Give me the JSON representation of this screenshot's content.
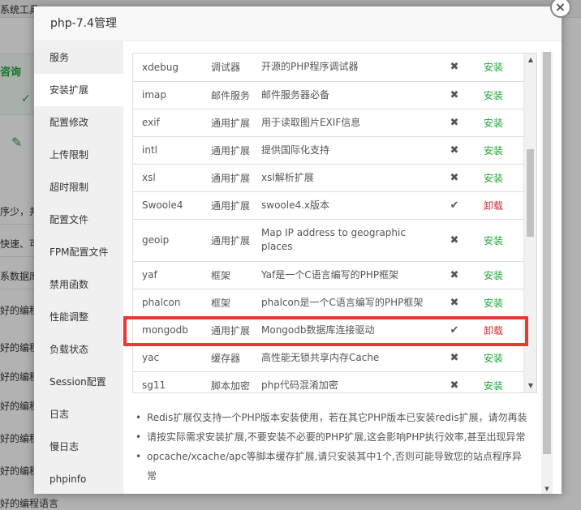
{
  "background": {
    "tab_label": "系统工具",
    "green_heading": "咨询",
    "lines": [
      "序少，并",
      "快速、可",
      "系数据库",
      "好的编程",
      "好的编程",
      "好的编程",
      "好的编程",
      "好的编程",
      "好的编程",
      "好的编程语言"
    ]
  },
  "dialog": {
    "title": "php-7.4管理",
    "close_label": "×"
  },
  "sidebar": {
    "items": [
      {
        "label": "服务"
      },
      {
        "label": "安装扩展"
      },
      {
        "label": "配置修改"
      },
      {
        "label": "上传限制"
      },
      {
        "label": "超时限制"
      },
      {
        "label": "配置文件"
      },
      {
        "label": "FPM配置文件"
      },
      {
        "label": "禁用函数"
      },
      {
        "label": "性能调整"
      },
      {
        "label": "负载状态"
      },
      {
        "label": "Session配置"
      },
      {
        "label": "日志"
      },
      {
        "label": "慢日志"
      },
      {
        "label": "phpinfo"
      }
    ]
  },
  "extensions": {
    "status_icons": {
      "installed": "✔",
      "not_installed": "✖"
    },
    "rows": [
      {
        "name": "xdebug",
        "type": "调试器",
        "desc": "开源的PHP程序调试器",
        "status": "not_installed",
        "action": "安装"
      },
      {
        "name": "imap",
        "type": "邮件服务",
        "desc": "邮件服务器必备",
        "status": "not_installed",
        "action": "安装"
      },
      {
        "name": "exif",
        "type": "通用扩展",
        "desc": "用于读取图片EXIF信息",
        "status": "not_installed",
        "action": "安装"
      },
      {
        "name": "intl",
        "type": "通用扩展",
        "desc": "提供国际化支持",
        "status": "not_installed",
        "action": "安装"
      },
      {
        "name": "xsl",
        "type": "通用扩展",
        "desc": "xsl解析扩展",
        "status": "not_installed",
        "action": "安装"
      },
      {
        "name": "Swoole4",
        "type": "通用扩展",
        "desc": "swoole4.x版本",
        "status": "installed",
        "action": "卸载"
      },
      {
        "name": "geoip",
        "type": "通用扩展",
        "desc": "Map IP address to geographic places",
        "status": "not_installed",
        "action": "安装"
      },
      {
        "name": "yaf",
        "type": "框架",
        "desc": "Yaf是一个C语言编写的PHP框架",
        "status": "not_installed",
        "action": "安装"
      },
      {
        "name": "phalcon",
        "type": "框架",
        "desc": "phalcon是一个C语言编写的PHP框架",
        "status": "not_installed",
        "action": "安装"
      },
      {
        "name": "mongodb",
        "type": "通用扩展",
        "desc": "Mongodb数据库连接驱动",
        "status": "installed",
        "action": "卸载"
      },
      {
        "name": "yac",
        "type": "缓存器",
        "desc": "高性能无锁共享内存Cache",
        "status": "not_installed",
        "action": "安装"
      },
      {
        "name": "sg11",
        "type": "脚本加密",
        "desc": "php代码混淆加密",
        "status": "not_installed",
        "action": "安装"
      }
    ]
  },
  "notes": [
    "Redis扩展仅支持一个PHP版本安装使用，若在其它PHP版本已安装redis扩展，请勿再装",
    "请按实际需求安装扩展,不要安装不必要的PHP扩展,这会影响PHP执行效率,甚至出现异常",
    "opcache/xcache/apc等脚本缓存扩展,请只安装其中1个,否则可能导致您的站点程序异常"
  ],
  "colors": {
    "install": "#20a53a",
    "uninstall": "#c9302c",
    "highlight": "#e53935"
  }
}
